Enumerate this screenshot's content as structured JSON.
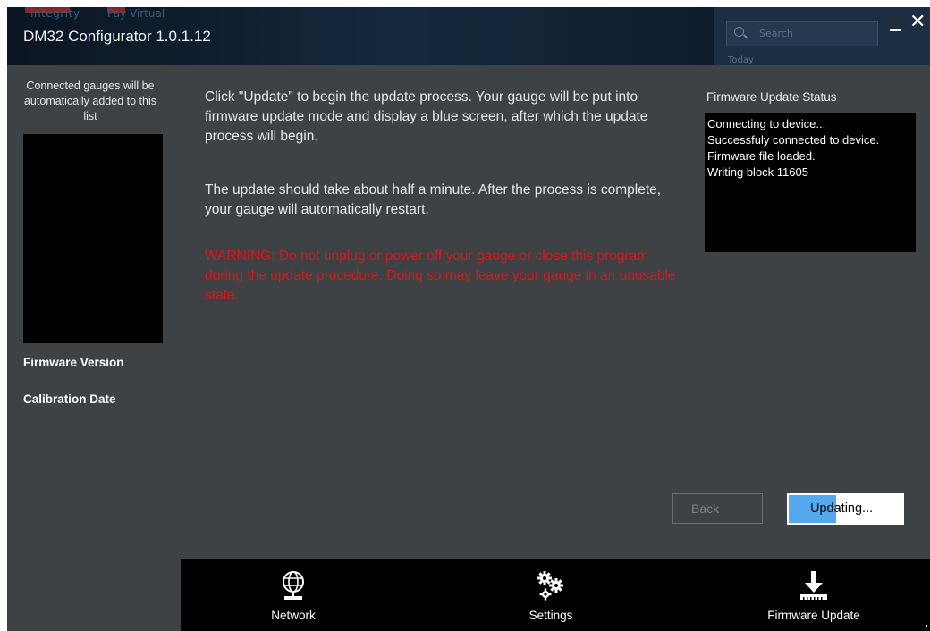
{
  "window": {
    "title": "DM32 Configurator 1.0.1.12",
    "minimize_glyph": "—",
    "close_glyph": "✕"
  },
  "background": {
    "desktop_labels": [
      "Integrity",
      "Pay Virtual"
    ],
    "search_placeholder": "Search",
    "today_label": "Today"
  },
  "left_panel": {
    "intro": "Connected gauges will be automatically added to this list",
    "gauges": [],
    "firmware_version_label": "Firmware Version",
    "calibration_date_label": "Calibration Date"
  },
  "main": {
    "paragraph_1": "Click \"Update\" to begin the update process. Your gauge will be put into firmware update mode and display a blue screen, after which the update process will begin.",
    "paragraph_2": "The update should take about half a minute. After the process is complete, your gauge will automatically restart.",
    "warning": "WARNING: Do not unplug or power off your gauge or close this program during the update procedure. Doing so may leave your gauge in an unusable state."
  },
  "status": {
    "label": "Firmware Update Status",
    "lines": [
      "Connecting to device...",
      "Successfuly connected to device.",
      "Firmware file loaded.",
      "Writing block 11605"
    ]
  },
  "buttons": {
    "back_label": "Back",
    "update_label": "Updating...",
    "update_progress_percent": 42
  },
  "nav": {
    "items": [
      {
        "label": "Network",
        "icon": "network-globe-icon"
      },
      {
        "label": "Settings",
        "icon": "settings-gears-icon"
      },
      {
        "label": "Firmware Update",
        "icon": "firmware-download-icon"
      }
    ],
    "active": "Firmware Update"
  },
  "colors": {
    "window_bg": "#3f4244",
    "titlebar_bg": "#0d1a27",
    "warning": "#d8161c",
    "progress": "#54a9ee",
    "nav_bg": "#000000"
  }
}
